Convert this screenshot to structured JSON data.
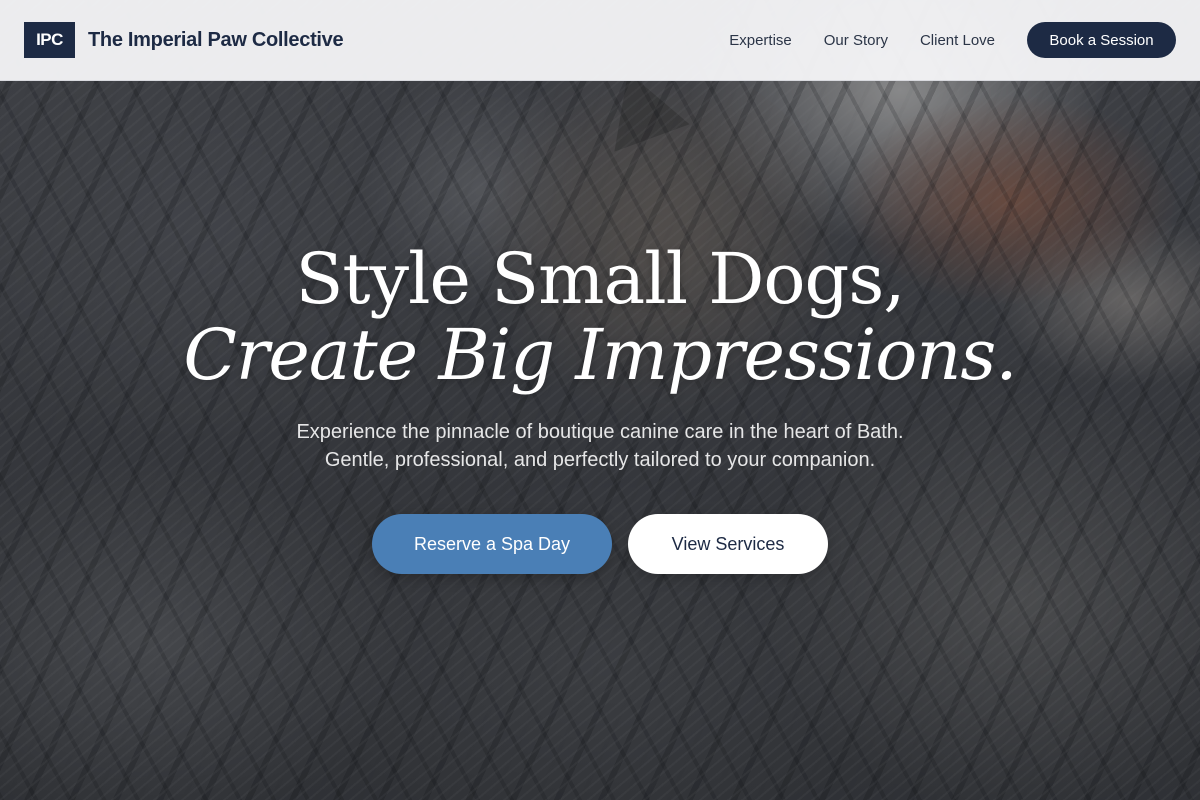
{
  "brand": {
    "logo_text": "IPC",
    "name": "The Imperial Paw Collective"
  },
  "nav": {
    "links": [
      {
        "label": "Expertise"
      },
      {
        "label": "Our Story"
      },
      {
        "label": "Client Love"
      }
    ],
    "cta_label": "Book a Session"
  },
  "hero": {
    "background_image": "tabby-cats-photo",
    "headline_line1": "Style Small Dogs,",
    "headline_line2": "Create Big Impressions.",
    "subtext_line1": "Experience the pinnacle of boutique canine care in the heart of Bath.",
    "subtext_line2": "Gentle, professional, and perfectly tailored to your companion.",
    "primary_cta": "Reserve a Spa Day",
    "secondary_cta": "View Services"
  },
  "colors": {
    "navy": "#1d2a44",
    "accent_blue": "#4a7fb6",
    "nav_background": "#f4f4f6",
    "white": "#ffffff"
  }
}
